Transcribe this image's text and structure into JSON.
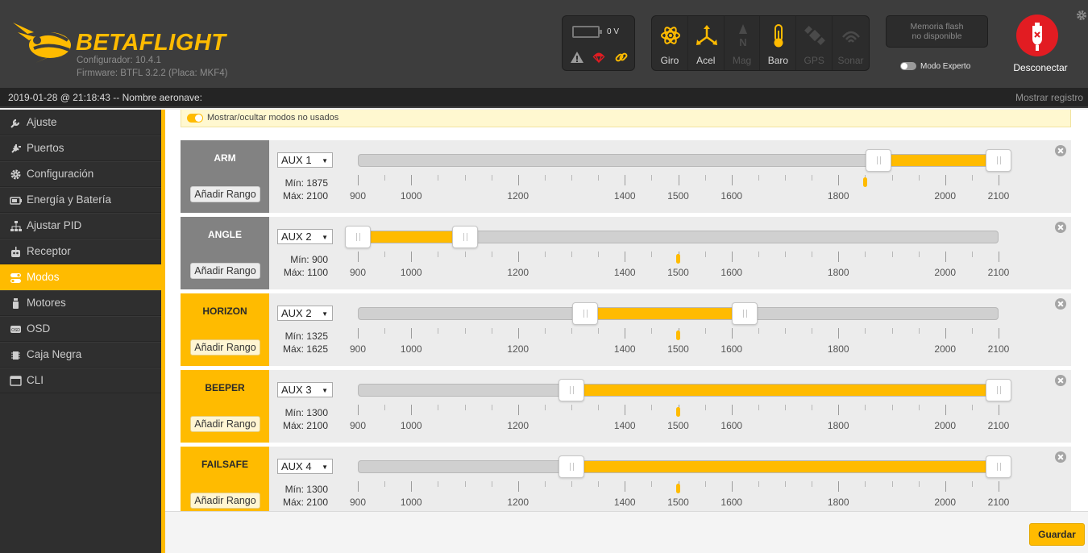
{
  "header": {
    "brand": "BETAFLIGHT",
    "configurator": "Configurador: 10.4.1",
    "firmware": "Firmware: BTFL 3.2.2 (Placa: MKF4)",
    "voltage": "0 V",
    "flash_line1": "Memoria flash",
    "flash_line2": "no disponible",
    "expert_mode": "Modo Experto",
    "disconnect": "Desconectar",
    "sensors": [
      {
        "label": "Giro",
        "icon": "gyro-icon",
        "active": true
      },
      {
        "label": "Acel",
        "icon": "accel-icon",
        "active": true
      },
      {
        "label": "Mag",
        "icon": "mag-icon",
        "active": false
      },
      {
        "label": "Baro",
        "icon": "baro-icon",
        "active": true
      },
      {
        "label": "GPS",
        "icon": "gps-icon",
        "active": false
      },
      {
        "label": "Sonar",
        "icon": "sonar-icon",
        "active": false
      }
    ]
  },
  "log_bar": {
    "text": "2019-01-28 @ 21:18:43 -- Nombre aeronave:",
    "show_log": "Mostrar registro"
  },
  "sidebar": {
    "items": [
      {
        "label": "Ajuste",
        "icon": "wrench-icon",
        "active": false
      },
      {
        "label": "Puertos",
        "icon": "plug-icon",
        "active": false
      },
      {
        "label": "Configuración",
        "icon": "gear-icon",
        "active": false
      },
      {
        "label": "Energía y Batería",
        "icon": "battery-icon",
        "active": false
      },
      {
        "label": "Ajustar PID",
        "icon": "sitemap-icon",
        "active": false
      },
      {
        "label": "Receptor",
        "icon": "robot-icon",
        "active": false
      },
      {
        "label": "Modos",
        "icon": "toggles-icon",
        "active": true
      },
      {
        "label": "Motores",
        "icon": "motor-icon",
        "active": false
      },
      {
        "label": "OSD",
        "icon": "osd-icon",
        "active": false
      },
      {
        "label": "Caja Negra",
        "icon": "chip-icon",
        "active": false
      },
      {
        "label": "CLI",
        "icon": "terminal-icon",
        "active": false
      }
    ]
  },
  "content": {
    "toggle_unused": "Mostrar/ocultar modos no usados",
    "add_range_label": "Añadir Rango",
    "scale_ticks": [
      900,
      1000,
      1200,
      1400,
      1500,
      1600,
      1800,
      2000,
      2100
    ],
    "colors": {
      "accent": "#ffbb00",
      "inactive": "#828282"
    },
    "modes": [
      {
        "name": "ARM",
        "aux": "AUX 1",
        "min_text": "Mín: 1875",
        "max_text": "Máx: 2100",
        "min": 1875,
        "max": 2100,
        "channel": 1850,
        "active": false
      },
      {
        "name": "ANGLE",
        "aux": "AUX 2",
        "min_text": "Mín: 900",
        "max_text": "Máx: 1100",
        "min": 900,
        "max": 1100,
        "channel": 1500,
        "active": false
      },
      {
        "name": "HORIZON",
        "aux": "AUX 2",
        "min_text": "Mín: 1325",
        "max_text": "Máx: 1625",
        "min": 1325,
        "max": 1625,
        "channel": 1500,
        "active": true
      },
      {
        "name": "BEEPER",
        "aux": "AUX 3",
        "min_text": "Mín: 1300",
        "max_text": "Máx: 2100",
        "min": 1300,
        "max": 2100,
        "channel": 1500,
        "active": true
      },
      {
        "name": "FAILSAFE",
        "aux": "AUX 4",
        "min_text": "Mín: 1300",
        "max_text": "Máx: 2100",
        "min": 1300,
        "max": 2100,
        "channel": 1500,
        "active": true
      }
    ]
  },
  "footer": {
    "save": "Guardar"
  }
}
